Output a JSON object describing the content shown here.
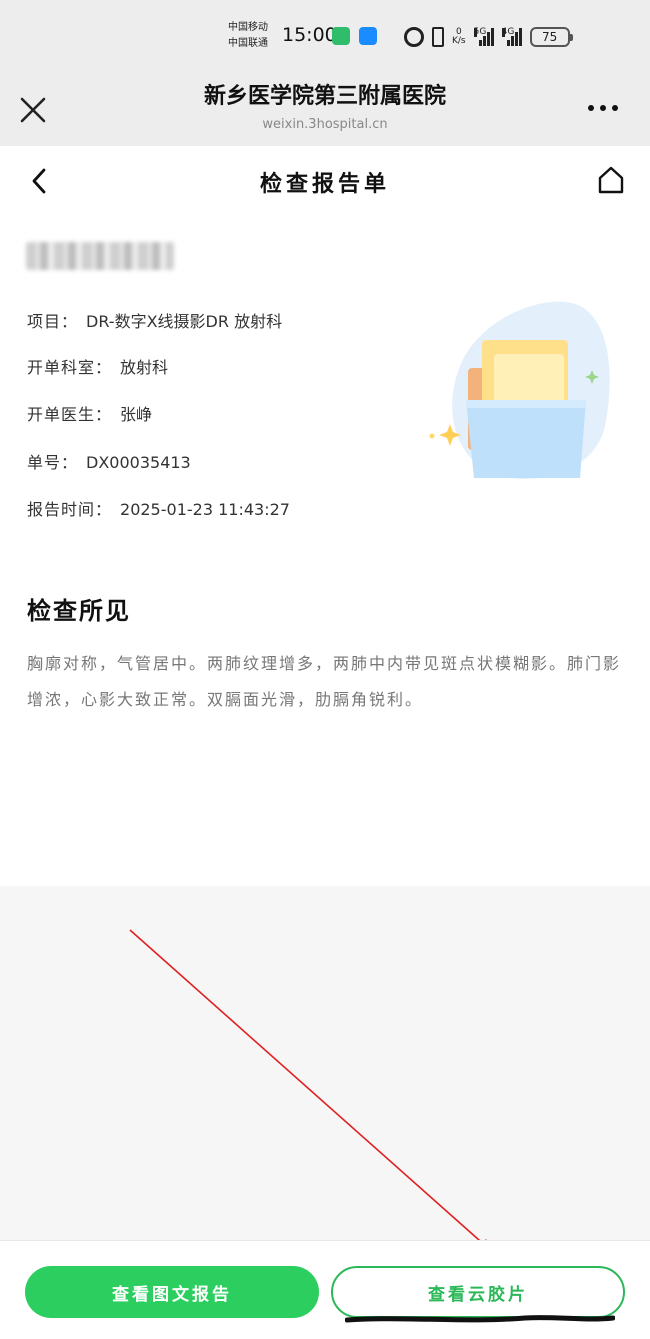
{
  "status_bar": {
    "carrier_1": "中国移动",
    "carrier_2": "中国联通",
    "time": "15:00",
    "net_speed_value": "0",
    "net_speed_unit": "K/s",
    "signal_1": "5G",
    "signal_2": "4G",
    "battery": "75"
  },
  "wechat_header": {
    "title": "新乡医学院第三附属医院",
    "url": "weixin.3hospital.cn"
  },
  "page": {
    "title": "检查报告单",
    "fields": [
      {
        "label": "项目：",
        "value": "DR-数字X线摄影DR 放射科"
      },
      {
        "label": "开单科室：",
        "value": "放射科"
      },
      {
        "label": "开单医生：",
        "value": "张峥"
      },
      {
        "label": "单号：",
        "value": "DX00035413"
      },
      {
        "label": "报告时间：",
        "value": "2025-01-23 11:43:27"
      }
    ],
    "findings_title": "检查所见",
    "findings_text": "胸廓对称，气管居中。两肺纹理增多，两肺中内带见斑点状模糊影。肺门影增浓，心影大致正常。双膈面光滑，肋膈角锐利。"
  },
  "bottom": {
    "primary_label": "查看图文报告",
    "secondary_label": "查看云胶片"
  },
  "colors": {
    "accent": "#2ccf5f",
    "annotation": "#e02020"
  }
}
